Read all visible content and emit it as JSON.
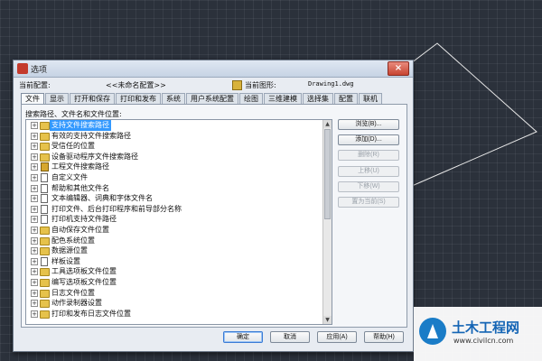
{
  "window": {
    "title": "选项",
    "close_label": "×"
  },
  "profile": {
    "label": "当前配置:",
    "value": "<<未命名配置>>",
    "drawing_label": "当前图形:",
    "drawing_value": "Drawing1.dwg"
  },
  "tabs": [
    "文件",
    "显示",
    "打开和保存",
    "打印和发布",
    "系统",
    "用户系统配置",
    "绘图",
    "三维建模",
    "选择集",
    "配置",
    "联机"
  ],
  "active_tab": "文件",
  "panel": {
    "caption": "搜索路径、文件名和文件位置:",
    "tree_items": [
      {
        "label": "支持文件搜索路径",
        "icon": "folder-icon",
        "selected": true
      },
      {
        "label": "有效的支持文件搜索路径",
        "icon": "folder-icon"
      },
      {
        "label": "受信任的位置",
        "icon": "folder-icon"
      },
      {
        "label": "设备驱动程序文件搜索路径",
        "icon": "folder-icon"
      },
      {
        "label": "工程文件搜索路径",
        "icon": "book-icon"
      },
      {
        "label": "自定义文件",
        "icon": "file-icon"
      },
      {
        "label": "帮助和其他文件名",
        "icon": "file-icon"
      },
      {
        "label": "文本编辑器、词典和字体文件名",
        "icon": "file-icon"
      },
      {
        "label": "打印文件、后台打印程序和前导部分名称",
        "icon": "file-icon"
      },
      {
        "label": "打印机支持文件路径",
        "icon": "file-icon"
      },
      {
        "label": "自动保存文件位置",
        "icon": "folder-icon"
      },
      {
        "label": "配色系统位置",
        "icon": "folder-icon"
      },
      {
        "label": "数据源位置",
        "icon": "folder-icon"
      },
      {
        "label": "样板设置",
        "icon": "file-icon"
      },
      {
        "label": "工具选项板文件位置",
        "icon": "folder-icon"
      },
      {
        "label": "编写选项板文件位置",
        "icon": "folder-icon"
      },
      {
        "label": "日志文件位置",
        "icon": "folder-icon"
      },
      {
        "label": "动作录制器设置",
        "icon": "folder-icon"
      },
      {
        "label": "打印和发布日志文件位置",
        "icon": "folder-icon"
      }
    ],
    "side_buttons": {
      "browse": "浏览(B)...",
      "add": "添加(D)...",
      "remove": "删除(R)",
      "move_up": "上移(U)",
      "move_down": "下移(W)",
      "set_current": "置为当前(S)"
    }
  },
  "footer": {
    "ok": "确定",
    "cancel": "取消",
    "apply": "应用(A)",
    "help": "帮助(H)"
  },
  "watermark": {
    "title": "土木工程网",
    "url": "www.civilcn.com"
  }
}
